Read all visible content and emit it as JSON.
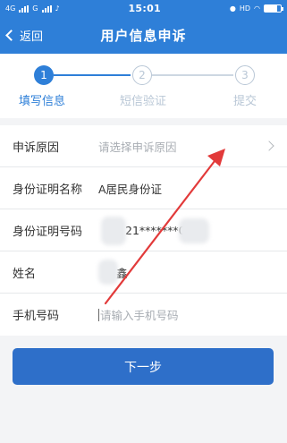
{
  "statusbar": {
    "left": "4G",
    "left2": "G",
    "time": "15:01",
    "right": "HD"
  },
  "nav": {
    "back": "返回",
    "title": "用户信息申诉"
  },
  "steps": [
    {
      "num": "1",
      "label": "填写信息"
    },
    {
      "num": "2",
      "label": "短信验证"
    },
    {
      "num": "3",
      "label": "提交"
    }
  ],
  "form": {
    "reason": {
      "label": "申诉原因",
      "placeholder": "请选择申诉原因"
    },
    "id_type": {
      "label": "身份证明名称",
      "value": "A居民身份证"
    },
    "id_number": {
      "label": "身份证明号码",
      "value": "21*******0"
    },
    "name": {
      "label": "姓名",
      "value": "鑫"
    },
    "phone": {
      "label": "手机号码",
      "placeholder": "请输入手机号码"
    }
  },
  "next_button": "下一步",
  "colors": {
    "primary": "#2e7fd8",
    "button": "#2e6fc9",
    "annotation": "#e23a3a"
  }
}
